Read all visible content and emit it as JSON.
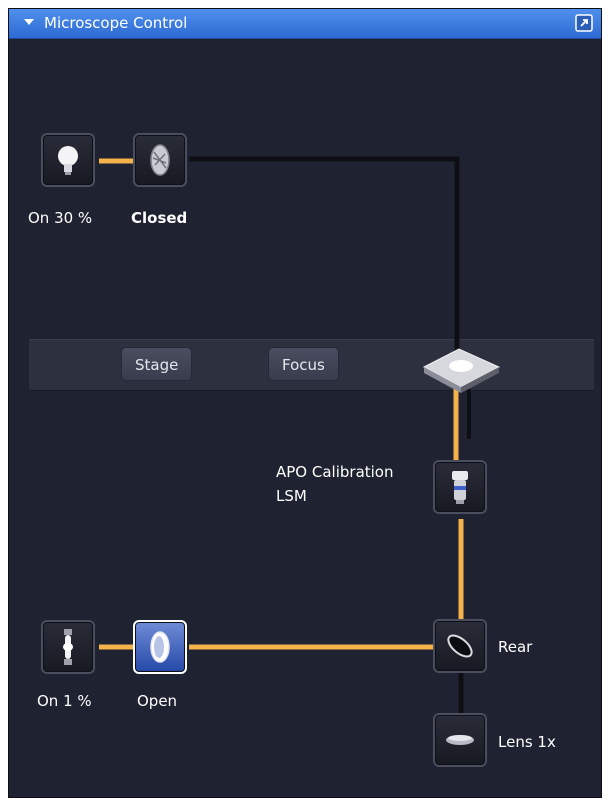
{
  "window": {
    "title": "Microscope Control"
  },
  "transmitted": {
    "lamp_status": "On 30 %",
    "shutter_status": "Closed"
  },
  "stage_bar": {
    "stage_label": "Stage",
    "focus_label": "Focus"
  },
  "objective": {
    "name_line1": "APO Calibration",
    "name_line2": "LSM"
  },
  "reflected": {
    "lamp_status": "On 1 %",
    "shutter_status": "Open",
    "mirror_label": "Rear",
    "lens_label": "Lens 1x"
  },
  "colors": {
    "panel_background": "#1f2230",
    "titlebar": "#3b7be0",
    "light_path_active": "#f5b24a",
    "light_path_inactive": "#0d0f14",
    "shutter_open": "#3c63c4"
  },
  "icons": {
    "collapse": "chevron-down-icon",
    "undock": "undock-icon",
    "halogen_lamp": "lightbulb-icon",
    "transmitted_shutter": "shutter-closed-icon",
    "stage": "stage-icon",
    "objective": "objective-icon",
    "fluorescence_lamp": "fluorescence-lamp-icon",
    "reflected_shutter": "shutter-open-icon",
    "mirror": "mirror-icon",
    "lens": "lens-icon"
  }
}
